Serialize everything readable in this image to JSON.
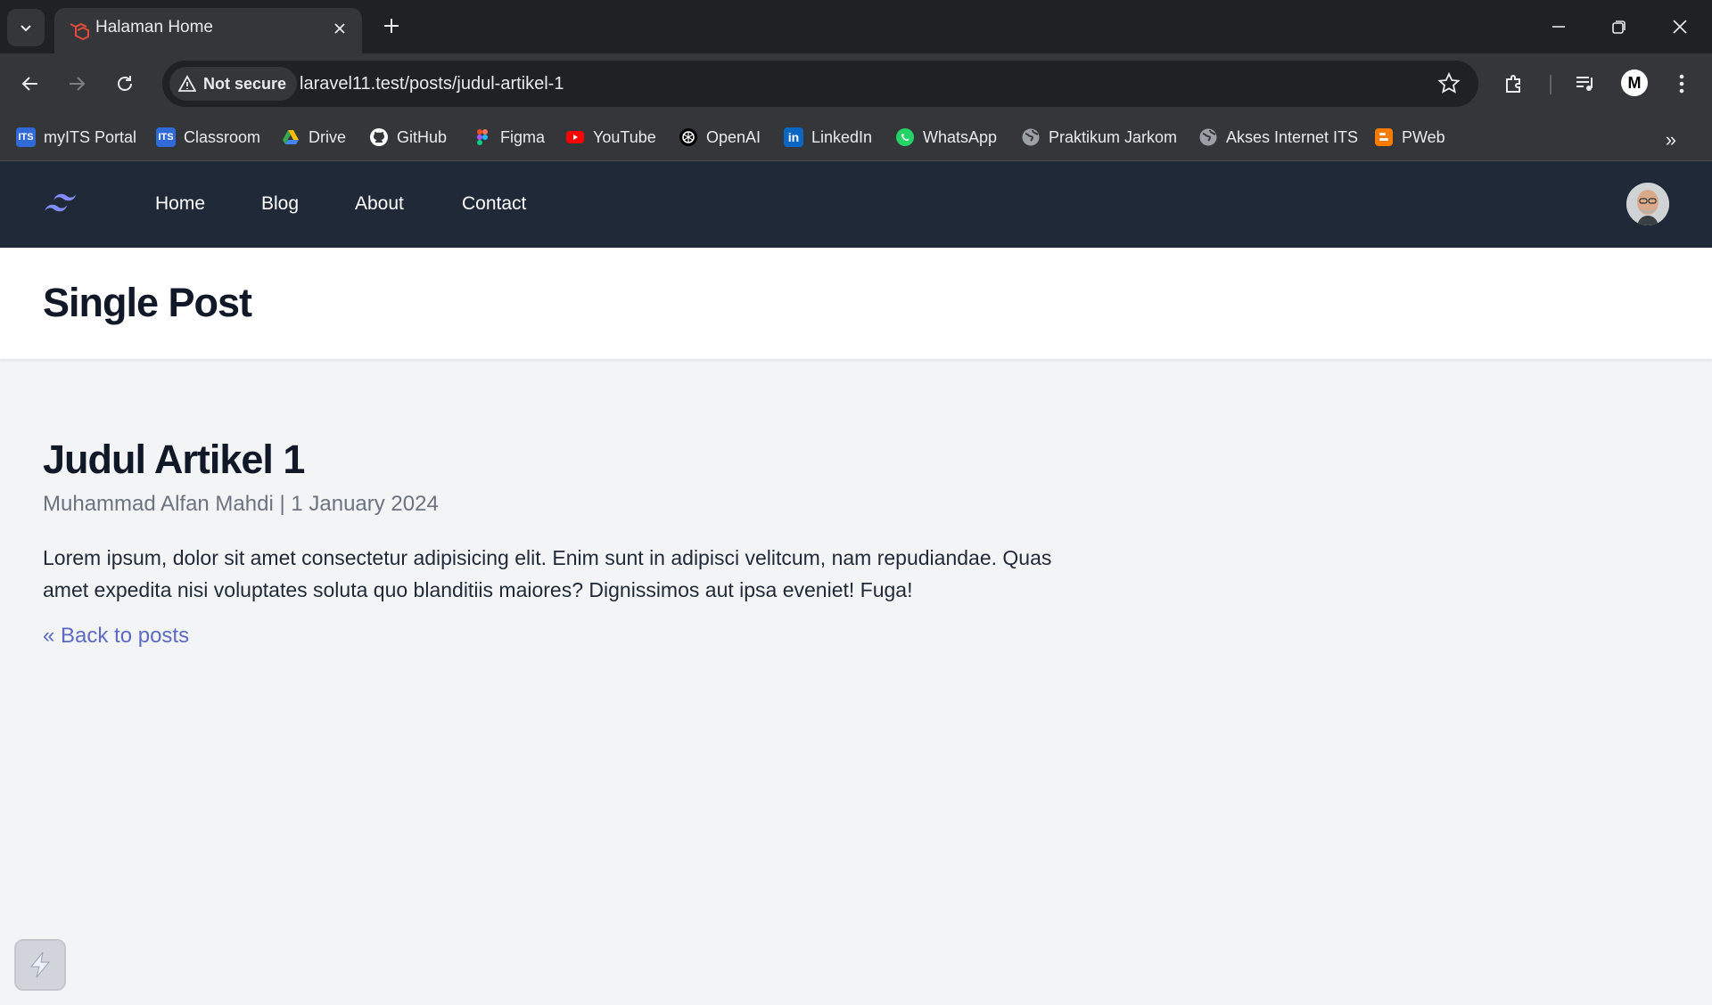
{
  "browser": {
    "tab_title": "Halaman Home",
    "security_label": "Not secure",
    "url_host": "laravel11.test",
    "url_path": "/posts/judul-artikel-1",
    "profile_initial": "M"
  },
  "bookmarks": [
    {
      "label": "myITS Portal",
      "icon": "its-icon",
      "color": "#2563eb"
    },
    {
      "label": "Classroom",
      "icon": "its-icon",
      "color": "#2563eb"
    },
    {
      "label": "Drive",
      "icon": "drive-icon",
      "color": "#34a853"
    },
    {
      "label": "GitHub",
      "icon": "github-icon",
      "color": "#ffffff"
    },
    {
      "label": "Figma",
      "icon": "figma-icon",
      "color": "#f24e1e"
    },
    {
      "label": "YouTube",
      "icon": "youtube-icon",
      "color": "#ff0000"
    },
    {
      "label": "OpenAI",
      "icon": "openai-icon",
      "color": "#ffffff"
    },
    {
      "label": "LinkedIn",
      "icon": "linkedin-icon",
      "color": "#0a66c2"
    },
    {
      "label": "WhatsApp",
      "icon": "whatsapp-icon",
      "color": "#25d366"
    },
    {
      "label": "Praktikum Jarkom",
      "icon": "globe-icon",
      "color": "#9aa0a6"
    },
    {
      "label": "Akses Internet ITS",
      "icon": "globe-icon",
      "color": "#9aa0a6"
    },
    {
      "label": "PWeb",
      "icon": "blogger-icon",
      "color": "#f57c00"
    }
  ],
  "nav": {
    "links": [
      "Home",
      "Blog",
      "About",
      "Contact"
    ]
  },
  "page": {
    "title": "Single Post"
  },
  "post": {
    "title": "Judul Artikel 1",
    "meta": "Muhammad Alfan Mahdi | 1 January 2024",
    "body": "Lorem ipsum, dolor sit amet consectetur adipisicing elit. Enim sunt in adipisci velitcum, nam repudiandae. Quas amet expedita nisi voluptates soluta quo blanditiis maiores? Dignissimos aut ipsa eveniet! Fuga!",
    "back_link": "« Back to posts"
  },
  "colors": {
    "nav_bg": "#1f2937",
    "accent": "#5c6ac4",
    "page_bg": "#f3f4f6"
  }
}
